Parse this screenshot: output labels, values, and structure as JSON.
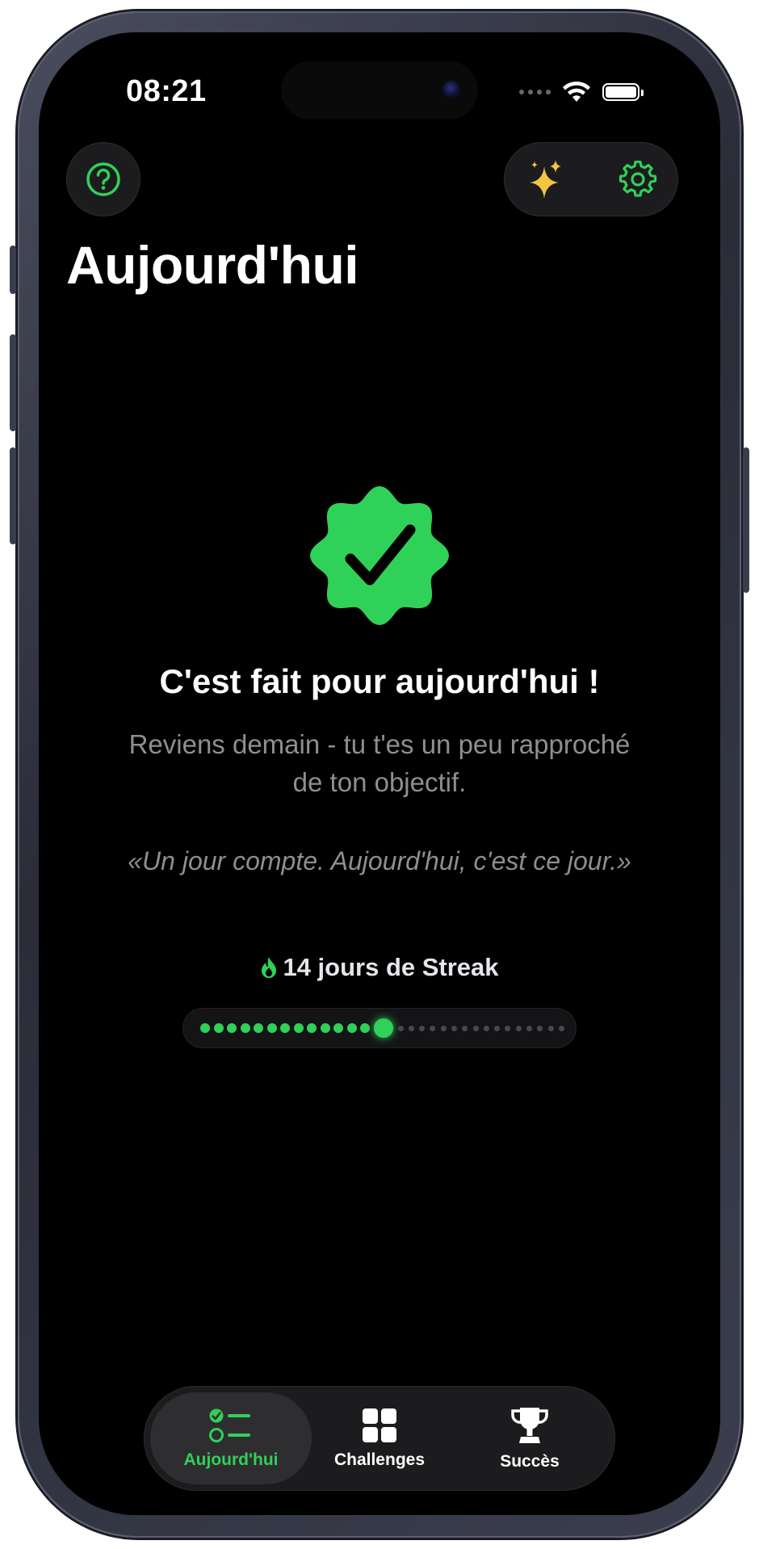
{
  "status_bar": {
    "time": "08:21"
  },
  "header": {
    "title": "Aujourd'hui",
    "help_icon": "question-circle-icon",
    "sparkle_icon": "sparkles-icon",
    "settings_icon": "gear-icon"
  },
  "completion": {
    "badge_icon": "checkmark-seal-icon",
    "title": "C'est fait pour aujourd'hui !",
    "subtitle": "Reviens demain - tu t'es un peu rapproché de ton objectif.",
    "quote": "«Un jour compte. Aujourd'hui, c'est ce jour.»"
  },
  "streak": {
    "icon": "flame-icon",
    "label": "14 jours de Streak",
    "completed_days": 14,
    "total_days": 30
  },
  "tabbar": {
    "tabs": [
      {
        "label": "Aujourd'hui",
        "icon": "checklist-icon",
        "active": true
      },
      {
        "label": "Challenges",
        "icon": "grid-icon",
        "active": false
      },
      {
        "label": "Succès",
        "icon": "trophy-icon",
        "active": false
      }
    ]
  },
  "colors": {
    "accent": "#30d158",
    "background": "#000000",
    "secondary_text": "#8e8e93",
    "sparkle": "#f4c542"
  }
}
